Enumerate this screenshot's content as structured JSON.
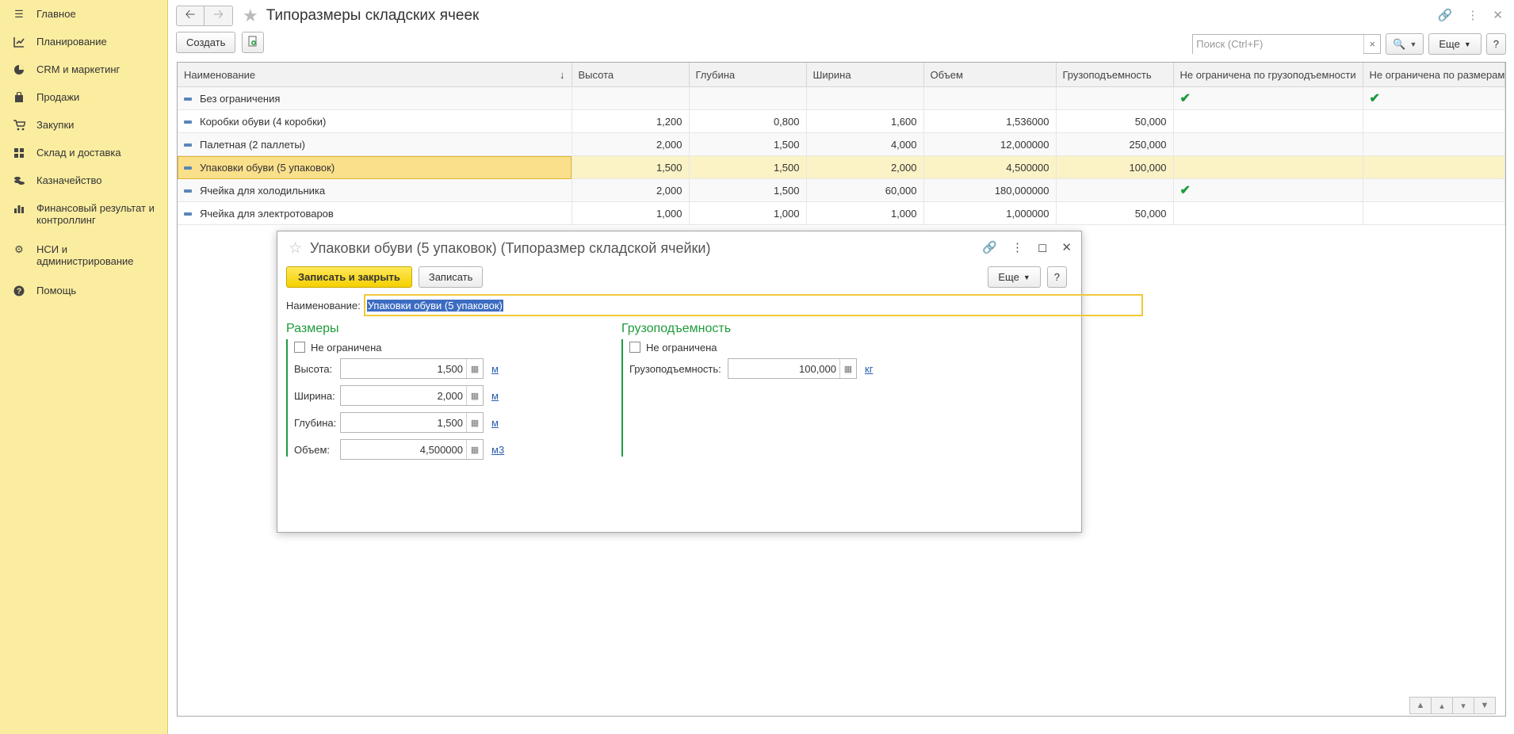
{
  "sidebar": {
    "items": [
      {
        "label": "Главное",
        "icon": "menu-icon"
      },
      {
        "label": "Планирование",
        "icon": "planning-icon"
      },
      {
        "label": "CRM и маркетинг",
        "icon": "crm-icon"
      },
      {
        "label": "Продажи",
        "icon": "bag-icon"
      },
      {
        "label": "Закупки",
        "icon": "cart-icon"
      },
      {
        "label": "Склад и доставка",
        "icon": "warehouse-icon"
      },
      {
        "label": "Казначейство",
        "icon": "treasury-icon"
      },
      {
        "label": "Финансовый результат и контроллинг",
        "icon": "chart-icon"
      },
      {
        "label": "НСИ и администрирование",
        "icon": "gear-icon"
      },
      {
        "label": "Помощь",
        "icon": "help-icon"
      }
    ]
  },
  "header": {
    "title": "Типоразмеры складских ячеек"
  },
  "toolbar": {
    "create_label": "Создать",
    "search_placeholder": "Поиск (Ctrl+F)",
    "search_clear": "×",
    "more_label": "Еще",
    "help_label": "?"
  },
  "table": {
    "columns": [
      "Наименование",
      "Высота",
      "Глубина",
      "Ширина",
      "Объем",
      "Грузоподъемность",
      "Не ограничена по грузоподъемности",
      "Не ограничена по размерам"
    ],
    "rows": [
      {
        "name": "Без ограничения",
        "height": "",
        "depth": "",
        "width": "",
        "volume": "",
        "capacity": "",
        "unl_cap": "✔",
        "unl_size": "✔"
      },
      {
        "name": "Коробки обуви (4 коробки)",
        "height": "1,200",
        "depth": "0,800",
        "width": "1,600",
        "volume": "1,536000",
        "capacity": "50,000",
        "unl_cap": "",
        "unl_size": ""
      },
      {
        "name": "Палетная (2 паллеты)",
        "height": "2,000",
        "depth": "1,500",
        "width": "4,000",
        "volume": "12,000000",
        "capacity": "250,000",
        "unl_cap": "",
        "unl_size": ""
      },
      {
        "name": "Упаковки обуви (5 упаковок)",
        "height": "1,500",
        "depth": "1,500",
        "width": "2,000",
        "volume": "4,500000",
        "capacity": "100,000",
        "unl_cap": "",
        "unl_size": ""
      },
      {
        "name": "Ячейка для холодильника",
        "height": "2,000",
        "depth": "1,500",
        "width": "60,000",
        "volume": "180,000000",
        "capacity": "",
        "unl_cap": "✔",
        "unl_size": ""
      },
      {
        "name": "Ячейка для электротоваров",
        "height": "1,000",
        "depth": "1,000",
        "width": "1,000",
        "volume": "1,000000",
        "capacity": "50,000",
        "unl_cap": "",
        "unl_size": ""
      }
    ]
  },
  "dialog": {
    "title": "Упаковки обуви (5 упаковок) (Типоразмер складской ячейки)",
    "save_close_label": "Записать и закрыть",
    "save_label": "Записать",
    "more_label": "Еще",
    "help_label": "?",
    "name_label": "Наименование:",
    "name_value": "Упаковки обуви (5 упаковок)",
    "sizes": {
      "title": "Размеры",
      "unlimited_label": "Не ограничена",
      "fields": [
        {
          "label": "Высота:",
          "value": "1,500",
          "unit": "м"
        },
        {
          "label": "Ширина:",
          "value": "2,000",
          "unit": "м"
        },
        {
          "label": "Глубина:",
          "value": "1,500",
          "unit": "м"
        },
        {
          "label": "Объем:",
          "value": "4,500000",
          "unit": "м3"
        }
      ]
    },
    "capacity": {
      "title": "Грузоподъемность",
      "unlimited_label": "Не ограничена",
      "field_label": "Грузоподъемность:",
      "value": "100,000",
      "unit": "кг"
    }
  }
}
